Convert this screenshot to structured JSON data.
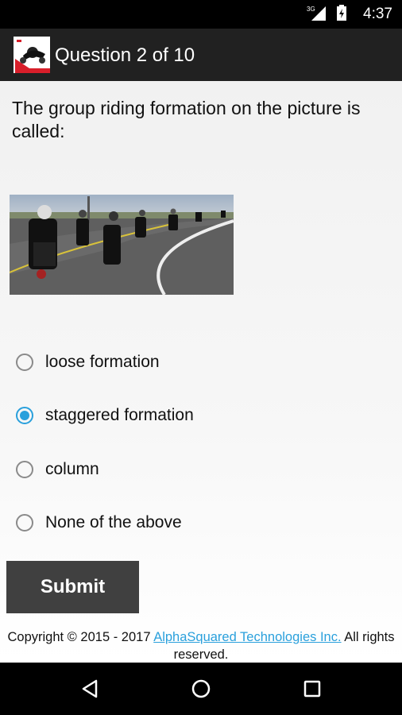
{
  "status": {
    "time": "4:37",
    "network_label": "3G"
  },
  "appbar": {
    "title": "Question 2 of 10",
    "icon": "motorcycle-logo-icon"
  },
  "question": {
    "text": "The group riding formation on the picture is called:"
  },
  "options": [
    {
      "label": "loose formation",
      "selected": false
    },
    {
      "label": "staggered formation",
      "selected": true
    },
    {
      "label": "column",
      "selected": false
    },
    {
      "label": "None of the above",
      "selected": false
    }
  ],
  "submit": {
    "label": "Submit"
  },
  "footer": {
    "prefix": "Copyright © 2015 - 2017 ",
    "link": "AlphaSquared Technologies Inc.",
    "suffix": " All rights reserved."
  },
  "colors": {
    "accent": "#2aa0dc",
    "appbar": "#212121",
    "button": "#404040"
  }
}
